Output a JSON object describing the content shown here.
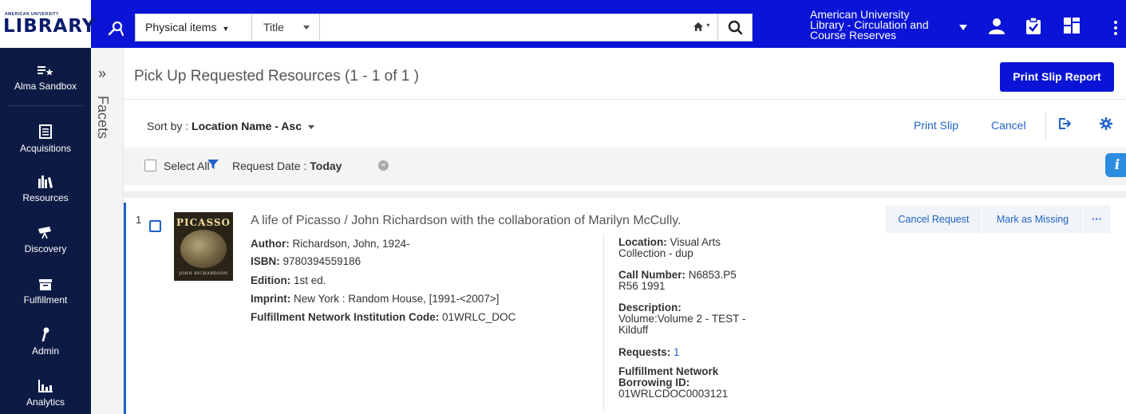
{
  "header": {
    "logo_small": "AMERICAN UNIVERSITY",
    "logo_big": "LIBRARY",
    "search_scope": "Physical items",
    "search_field": "Title",
    "search_value": "",
    "institution": "American University Library - Circulation and Course Reserves"
  },
  "nav": {
    "items": [
      {
        "label": "Alma Sandbox",
        "icon": "list-star-icon"
      },
      {
        "label": "Acquisitions",
        "icon": "ledger-icon"
      },
      {
        "label": "Resources",
        "icon": "books-icon"
      },
      {
        "label": "Discovery",
        "icon": "telescope-icon"
      },
      {
        "label": "Fulfillment",
        "icon": "archive-box-icon"
      },
      {
        "label": "Admin",
        "icon": "wrench-icon"
      },
      {
        "label": "Analytics",
        "icon": "bar-chart-icon"
      }
    ]
  },
  "facets": {
    "toggle": "»",
    "label": "Facets"
  },
  "page": {
    "title": "Pick Up Requested Resources (1 - 1 of 1 )",
    "print_report_label": "Print Slip Report"
  },
  "toolbar": {
    "sort_prefix": "Sort by : ",
    "sort_value": "Location Name - Asc",
    "print_slip": "Print Slip",
    "cancel": "Cancel"
  },
  "filters": {
    "select_all": "Select All",
    "request_date_label": "Request Date : ",
    "request_date_value": "Today",
    "info_label": "i"
  },
  "results": [
    {
      "index": "1",
      "cover_title": "PICASSO",
      "cover_author": "JOHN RICHARDSON",
      "title": "A life of Picasso / John Richardson with the collaboration of Marilyn McCully.",
      "author_label": "Author:",
      "author": " Richardson, John, 1924-",
      "isbn_label": "ISBN:",
      "isbn": " 9780394559186",
      "edition_label": "Edition:",
      "edition": " 1st ed.",
      "imprint_label": "Imprint:",
      "imprint": " New York : Random House, [1991-<2007>]",
      "fni_label": "Fulfillment Network Institution Code:",
      "fni": " 01WRLC_DOC",
      "location_label": "Location:",
      "location": " Visual Arts Collection - dup",
      "call_label": "Call Number:",
      "call": " N6853.P5 R56 1991",
      "description_label": "Description:",
      "description": "Volume:Volume 2 - TEST - Kilduff",
      "requests_label": "Requests:",
      "requests": "1",
      "borrowing_label": "Fulfillment Network Borrowing ID:",
      "borrowing": "01WRLCDOC0003121",
      "actions": {
        "cancel_request": "Cancel Request",
        "mark_missing": "Mark as Missing",
        "more": "···"
      }
    }
  ],
  "colors": {
    "brand_blue": "#0a14d6",
    "nav_bg": "#0d1b44",
    "link": "#1e63c7"
  }
}
